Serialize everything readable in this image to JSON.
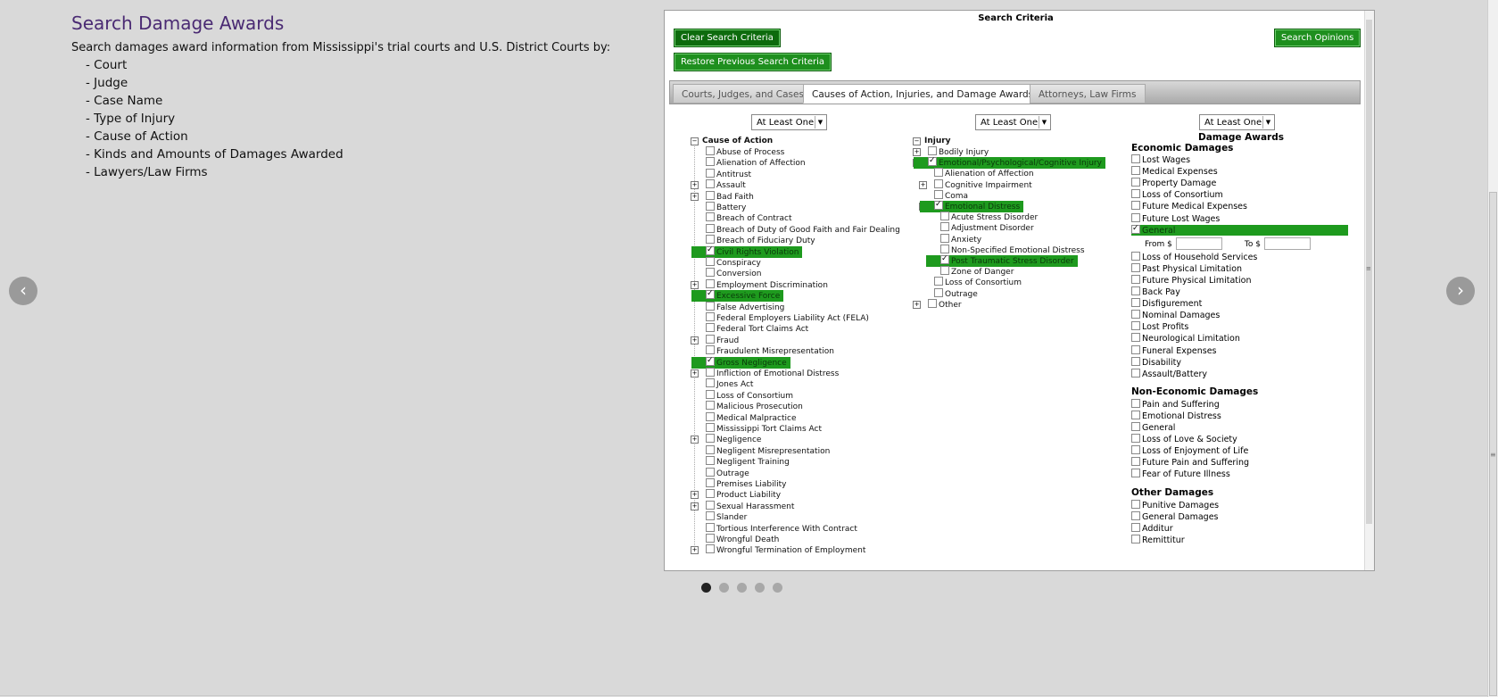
{
  "intro": {
    "title": "Search Damage Awards",
    "lead": "Search damages award information from Mississippi's trial courts and U.S. District Courts by:",
    "bullets": [
      "- Court",
      "- Judge",
      "- Case Name",
      "- Type of Injury",
      "- Cause of Action",
      "- Kinds and Amounts of Damages Awarded",
      "- Lawyers/Law Firms"
    ]
  },
  "carousel": {
    "prev_glyph": "‹",
    "next_glyph": "›",
    "dots": 5,
    "active_dot": 0
  },
  "screen": {
    "title": "Search Criteria",
    "buttons": {
      "clear": "Clear Search Criteria",
      "restore": "Restore Previous Search Criteria",
      "search": "Search Opinions"
    },
    "tabs": [
      "Courts, Judges, and Cases",
      "Causes of Action, Injuries, and Damage Awards",
      "Attorneys, Law Firms"
    ],
    "active_tab": 1,
    "selects": {
      "cause": "At Least One",
      "injury": "At Least One",
      "awards": "At Least One"
    },
    "cause": {
      "heading": "Cause of Action",
      "items": [
        {
          "label": "Abuse of Process"
        },
        {
          "label": "Alienation of Affection"
        },
        {
          "label": "Antitrust"
        },
        {
          "label": "Assault",
          "expand": true
        },
        {
          "label": "Bad Faith",
          "expand": true
        },
        {
          "label": "Battery"
        },
        {
          "label": "Breach of Contract"
        },
        {
          "label": "Breach of Duty of Good Faith and Fair Dealing"
        },
        {
          "label": "Breach of Fiduciary Duty"
        },
        {
          "label": "Civil Rights Violation",
          "checked": true
        },
        {
          "label": "Conspiracy"
        },
        {
          "label": "Conversion"
        },
        {
          "label": "Employment Discrimination",
          "expand": true
        },
        {
          "label": "Excessive Force",
          "checked": true
        },
        {
          "label": "False Advertising"
        },
        {
          "label": "Federal Employers Liability Act (FELA)"
        },
        {
          "label": "Federal Tort Claims Act"
        },
        {
          "label": "Fraud",
          "expand": true
        },
        {
          "label": "Fraudulent Misrepresentation"
        },
        {
          "label": "Gross Negligence",
          "checked": true
        },
        {
          "label": "Infliction of Emotional Distress",
          "expand": true
        },
        {
          "label": "Jones Act"
        },
        {
          "label": "Loss of Consortium"
        },
        {
          "label": "Malicious Prosecution"
        },
        {
          "label": "Medical Malpractice"
        },
        {
          "label": "Mississippi Tort Claims Act"
        },
        {
          "label": "Negligence",
          "expand": true
        },
        {
          "label": "Negligent Misrepresentation"
        },
        {
          "label": "Negligent Training"
        },
        {
          "label": "Outrage"
        },
        {
          "label": "Premises Liability"
        },
        {
          "label": "Product Liability",
          "expand": true
        },
        {
          "label": "Sexual Harassment",
          "expand": true
        },
        {
          "label": "Slander"
        },
        {
          "label": "Tortious Interference With Contract"
        },
        {
          "label": "Wrongful Death"
        },
        {
          "label": "Wrongful Termination of Employment",
          "expand": true
        }
      ]
    },
    "injury": {
      "heading": "Injury",
      "items": [
        {
          "label": "Bodily Injury",
          "level": 0,
          "expand": true
        },
        {
          "label": "Emotional/Psychological/Cognitive Injury",
          "level": 0,
          "collapse": true,
          "checked": true
        },
        {
          "label": "Alienation of Affection",
          "level": 1
        },
        {
          "label": "Cognitive Impairment",
          "level": 1,
          "expand": true
        },
        {
          "label": "Coma",
          "level": 1
        },
        {
          "label": "Emotional Distress",
          "level": 1,
          "collapse": true,
          "checked": true
        },
        {
          "label": "Acute Stress Disorder",
          "level": 2
        },
        {
          "label": "Adjustment Disorder",
          "level": 2
        },
        {
          "label": "Anxiety",
          "level": 2
        },
        {
          "label": "Non-Specified Emotional Distress",
          "level": 2
        },
        {
          "label": "Post Traumatic Stress Disorder",
          "level": 2,
          "checked": true
        },
        {
          "label": "Zone of Danger",
          "level": 2
        },
        {
          "label": "Loss of Consortium",
          "level": 1
        },
        {
          "label": "Outrage",
          "level": 1
        },
        {
          "label": "Other",
          "level": 0,
          "expand": true
        }
      ]
    },
    "awards": {
      "heading": "Damage Awards",
      "economic_heading": "Economic Damages",
      "economic": [
        {
          "label": "Lost Wages"
        },
        {
          "label": "Medical Expenses"
        },
        {
          "label": "Property Damage"
        },
        {
          "label": "Loss of Consortium"
        },
        {
          "label": "Future Medical Expenses"
        },
        {
          "label": "Future Lost Wages"
        },
        {
          "label": "General",
          "checked": true
        }
      ],
      "from_label": "From $",
      "to_label": "To $",
      "economic_more": [
        {
          "label": "Loss of Household Services"
        },
        {
          "label": "Past Physical Limitation"
        },
        {
          "label": "Future Physical Limitation"
        },
        {
          "label": "Back Pay"
        },
        {
          "label": "Disfigurement"
        },
        {
          "label": "Nominal Damages"
        },
        {
          "label": "Lost Profits"
        },
        {
          "label": "Neurological Limitation"
        },
        {
          "label": "Funeral Expenses"
        },
        {
          "label": "Disability"
        },
        {
          "label": "Assault/Battery"
        }
      ],
      "noneconomic_heading": "Non-Economic Damages",
      "noneconomic": [
        {
          "label": "Pain and Suffering"
        },
        {
          "label": "Emotional Distress"
        },
        {
          "label": "General"
        },
        {
          "label": "Loss of Love & Society"
        },
        {
          "label": "Loss of Enjoyment of Life"
        },
        {
          "label": "Future Pain and Suffering"
        },
        {
          "label": "Fear of Future Illness"
        }
      ],
      "other_heading": "Other Damages",
      "other": [
        {
          "label": "Punitive Damages"
        },
        {
          "label": "General Damages"
        },
        {
          "label": "Additur"
        },
        {
          "label": "Remittitur"
        }
      ]
    }
  },
  "colors": {
    "accent_green": "#1e9a1e",
    "title_purple": "#4a2a73"
  }
}
